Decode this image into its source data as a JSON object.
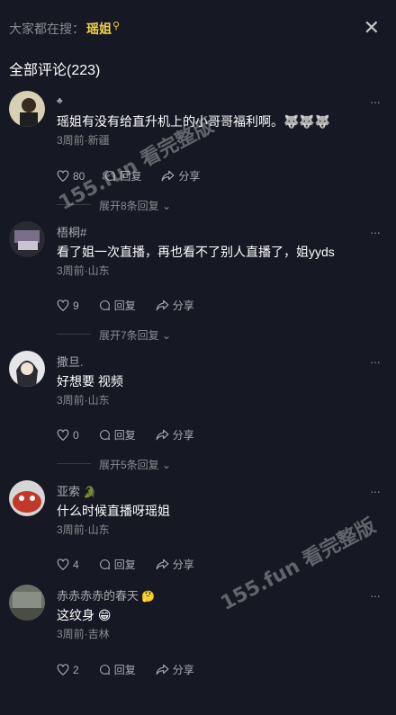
{
  "search": {
    "prefix": "大家都在搜：",
    "keyword": "瑶姐",
    "icon": "search-icon"
  },
  "header": {
    "title": "全部评论(223)"
  },
  "close_icon": "✕",
  "comments": [
    {
      "username": "",
      "badge": "",
      "content": "瑶姐有没有给直升机上的小哥哥福利啊。🐺🐺🐺",
      "meta": "3周前·新疆",
      "likes": "80",
      "reply_label": "回复",
      "share_label": "分享",
      "expand": "展开8条回复"
    },
    {
      "username": "梧桐#",
      "badge": "",
      "content": "看了姐一次直播，再也看不了别人直播了，姐yyds",
      "meta": "3周前·山东",
      "likes": "9",
      "reply_label": "回复",
      "share_label": "分享",
      "expand": "展开7条回复"
    },
    {
      "username": "撒旦.",
      "badge": "",
      "content": "好想要 视频",
      "meta": "3周前·山东",
      "likes": "0",
      "reply_label": "回复",
      "share_label": "分享",
      "expand": "展开5条回复"
    },
    {
      "username": "亚索",
      "badge": "🐊",
      "content": "什么时候直播呀瑶姐",
      "meta": "3周前·山东",
      "likes": "4",
      "reply_label": "回复",
      "share_label": "分享",
      "expand": ""
    },
    {
      "username": "赤赤赤赤的春天",
      "badge": "🤔",
      "content": "这纹身 😁",
      "meta": "3周前·吉林",
      "likes": "2",
      "reply_label": "回复",
      "share_label": "分享",
      "expand": ""
    }
  ],
  "watermark": {
    "text": "155.fun 看完整版"
  },
  "colors": {
    "background": "#161823",
    "accent": "#f5d24a"
  }
}
